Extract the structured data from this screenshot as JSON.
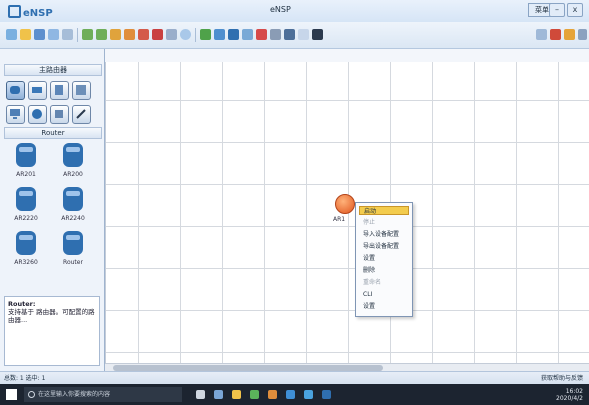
{
  "window": {
    "app_name": "eNSP",
    "title": "eNSP"
  },
  "title_controls": {
    "menu": "菜单",
    "minimize": "–",
    "close": "x"
  },
  "left_panel": {
    "header_top": "主路由器",
    "header_router": "Router",
    "routers": [
      {
        "label": "AR201"
      },
      {
        "label": "AR200"
      },
      {
        "label": "AR2220"
      },
      {
        "label": "AR2240"
      },
      {
        "label": "AR3260"
      },
      {
        "label": "Router"
      }
    ],
    "description_title": "Router:",
    "description_text": "支持基于 路由器。可配置的路由器..."
  },
  "canvas": {
    "node_label": "AR1"
  },
  "context_menu": {
    "items": [
      {
        "label": "启动",
        "state": "highlighted"
      },
      {
        "label": "停止",
        "state": "disabled"
      },
      {
        "label": "导入设备配置",
        "state": "normal"
      },
      {
        "label": "导出设备配置",
        "state": "normal"
      },
      {
        "label": "设置",
        "state": "normal"
      },
      {
        "label": "删除",
        "state": "normal"
      },
      {
        "label": "重命名",
        "state": "disabled"
      },
      {
        "label": "CLI",
        "state": "normal"
      },
      {
        "label": "设置",
        "state": "normal"
      }
    ]
  },
  "status_bar": {
    "left": "总数: 1 选中: 1",
    "right": "获取帮助与反馈"
  },
  "taskbar": {
    "search_placeholder": "在这里输入你要搜索的内容",
    "time": "16:02",
    "date": "2020/4/2"
  },
  "colors": {
    "accent": "#2f6fb0",
    "menu_highlight": "#f3cc4e",
    "router_node": "#e0561e"
  }
}
